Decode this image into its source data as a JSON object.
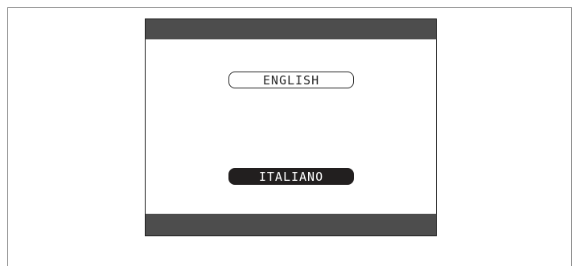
{
  "languages": {
    "english": "ENGLISH",
    "italiano": "ITALIANO"
  },
  "selected": "italiano",
  "colors": {
    "bar": "#4d4d4d",
    "selected_bg": "#221f1f",
    "text": "#2a2a2a"
  }
}
